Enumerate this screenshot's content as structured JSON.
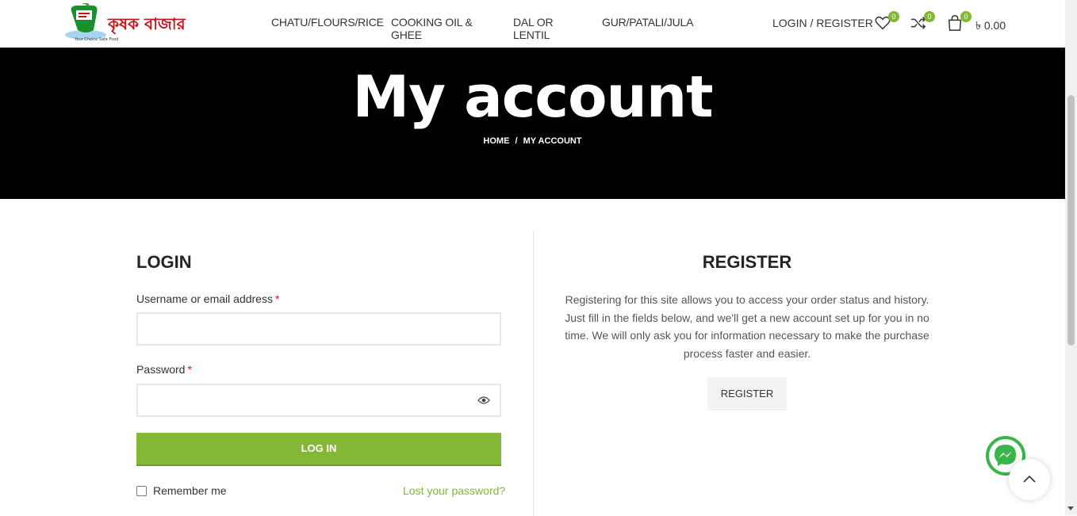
{
  "header": {
    "logo_text": "কৃষক বাজার",
    "logo_tagline": "Your Choice Safe Food",
    "nav": [
      "CHATU/FLOURS/RICE",
      "COOKING OIL & GHEE",
      "DAL OR LENTIL",
      "GUR/PATALI/JULA"
    ],
    "login_register": "LOGIN / REGISTER",
    "wishlist_count": "0",
    "compare_count": "0",
    "cart_count": "0",
    "cart_total": "৳ 0.00"
  },
  "hero": {
    "title": "My account",
    "breadcrumb_home": "HOME",
    "breadcrumb_sep": "/",
    "breadcrumb_current": "MY ACCOUNT"
  },
  "login": {
    "title": "LOGIN",
    "username_label": "Username or email address",
    "password_label": "Password",
    "required_mark": "*",
    "button": "LOG IN",
    "remember": "Remember me",
    "lost_password": "Lost your password?"
  },
  "register": {
    "title": "REGISTER",
    "text": "Registering for this site allows you to access your order status and history. Just fill in the fields below, and we'll get a new account set up for you in no time. We will only ask you for information necessary to make the purchase process faster and easier.",
    "button": "REGISTER"
  },
  "colors": {
    "accent": "#83b735",
    "hero_bg": "#000000",
    "required": "#e01020"
  },
  "icons": [
    "heart-icon",
    "shuffle-icon",
    "shopping-bag-icon",
    "eye-icon",
    "messenger-icon",
    "chevron-up-icon"
  ]
}
